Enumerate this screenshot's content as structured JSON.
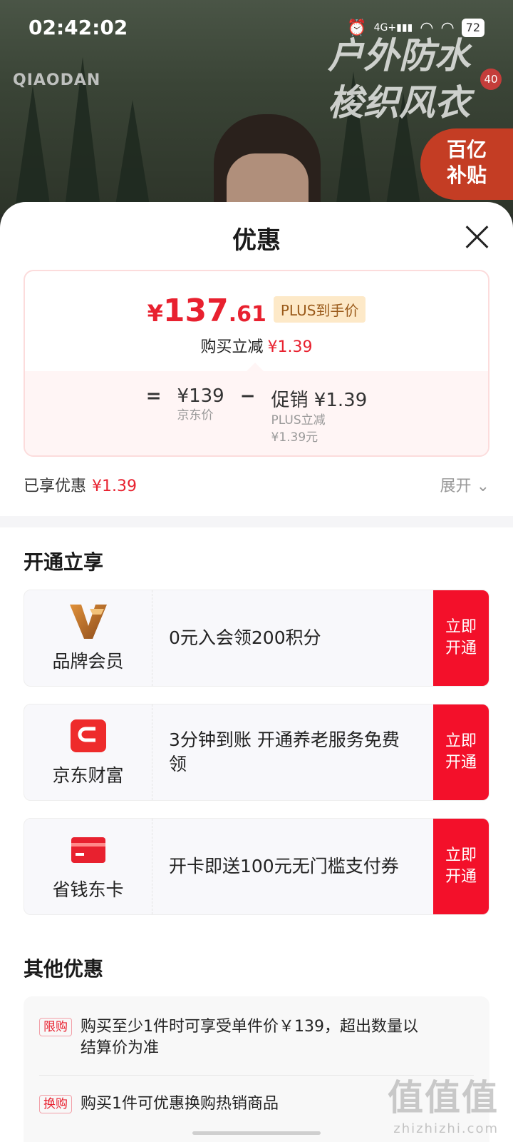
{
  "status_bar": {
    "time": "02:42:02",
    "network": "4G+",
    "battery": "72"
  },
  "background": {
    "brand_logo": "QIAODAN",
    "promo_line1": "户外防水",
    "promo_line2": "梭织风衣",
    "subsidy_line1": "百亿",
    "subsidy_line2": "补贴",
    "badge_count": "40"
  },
  "sheet": {
    "title": "优惠",
    "price": {
      "currency": "¥",
      "integer": "137",
      "decimal": ".61",
      "tag": "PLUS到手价",
      "instant_cut_label": "购买立减",
      "instant_cut_value": "¥1.39",
      "equals": "=",
      "jd_price": "¥139",
      "jd_price_label": "京东价",
      "minus": "−",
      "promo_label": "促销",
      "promo_value": "¥1.39",
      "promo_sub1": "PLUS立减",
      "promo_sub2": "¥1.39元"
    },
    "enjoyed_label": "已享优惠",
    "enjoyed_value": "¥1.39",
    "expand_label": "展开"
  },
  "open_section": {
    "title": "开通立享",
    "offers": [
      {
        "name": "品牌会员",
        "desc": "0元入会领200积分",
        "button": "立即开通"
      },
      {
        "name": "京东财富",
        "desc": "3分钟到账 开通养老服务免费领",
        "button": "立即开通"
      },
      {
        "name": "省钱东卡",
        "desc": "开卡即送100元无门槛支付券",
        "button": "立即开通"
      }
    ]
  },
  "other_section": {
    "title": "其他优惠",
    "rules": [
      {
        "tag": "限购",
        "text": "购买至少1件时可享受单件价￥139，超出数量以结算价为准"
      },
      {
        "tag": "换购",
        "text": "购买1件可优惠换购热销商品"
      }
    ]
  },
  "watermark": {
    "main": "值值值",
    "sub": "zhizhizhi.com"
  },
  "colors": {
    "accent_red": "#e8212f",
    "button_red": "#f3102a",
    "plus_gold": "#fde9c8"
  }
}
